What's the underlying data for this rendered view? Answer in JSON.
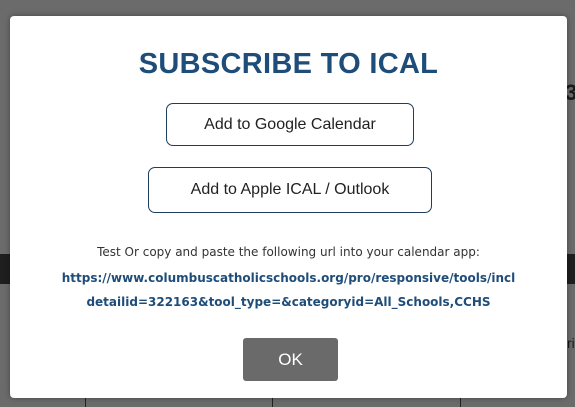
{
  "background": {
    "fragment_right_top": "3",
    "fragment_right_mid": "ri"
  },
  "modal": {
    "title": "SUBSCRIBE TO ICAL",
    "google_button_label": "Add to Google Calendar",
    "apple_button_label": "Add to Apple ICAL / Outlook",
    "instructions": "Test Or copy and paste the following url into your calendar app:",
    "url_line_1": "https://www.columbuscatholicschools.org/pro/responsive/tools/incl",
    "url_line_2": "detailid=322163&tool_type=&categoryid=All_Schools,CCHS",
    "ok_label": "OK"
  }
}
